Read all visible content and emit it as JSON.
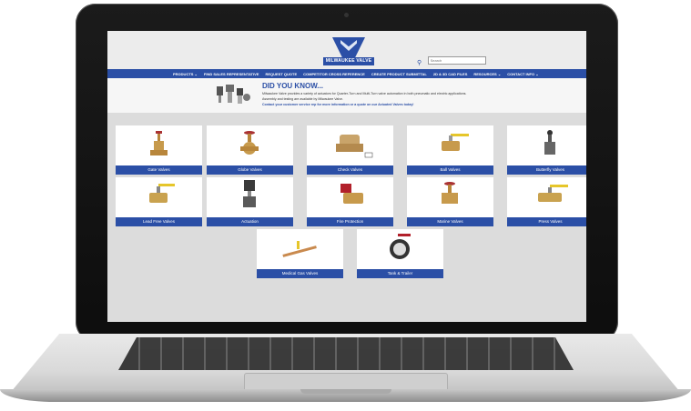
{
  "site": {
    "logo_text": "MILWAUKEE VALVE",
    "search_placeholder": "Search",
    "brand_color": "#2b4fa6"
  },
  "nav": [
    "PRODUCTS ⌄",
    "FIND SALES REPRESENTATIVE",
    "REQUEST QUOTE",
    "COMPETITOR CROSS REFERENCE",
    "CREATE PRODUCT SUBMITTAL",
    "2D & 3D CAD FILES",
    "RESOURCES ⌄",
    "CONTACT INFO ⌄"
  ],
  "did_you_know": {
    "title": "DID YOU KNOW...",
    "line1": "Milwaukee Valve provides a variety of actuators for Quarter-Turn and Multi-Turn valve automation in both pneumatic and electric applications.",
    "line2": "Assembly and testing are available by Milwaukee Valve.",
    "line3": "Contact your customer service rep for more information or a quote on our Actuated Valves today!"
  },
  "categories": [
    {
      "label": "Gate Valves",
      "icon": "gate-valve-icon"
    },
    {
      "label": "Globe Valves",
      "icon": "globe-valve-icon"
    },
    {
      "label": "Check Valves",
      "icon": "check-valve-icon"
    },
    {
      "label": "Ball Valves",
      "icon": "ball-valve-icon"
    },
    {
      "label": "Butterfly Valves",
      "icon": "butterfly-valve-icon"
    },
    {
      "label": "Lead Free Valves",
      "icon": "lead-free-valve-icon"
    },
    {
      "label": "Actuation",
      "icon": "actuator-icon"
    },
    {
      "label": "Fire Protection",
      "icon": "fire-protection-icon"
    },
    {
      "label": "Marine Valves",
      "icon": "marine-valve-icon"
    },
    {
      "label": "Press Valves",
      "icon": "press-valve-icon"
    },
    {
      "label": "Medical Gas Valves",
      "icon": "medical-gas-valve-icon"
    },
    {
      "label": "Tank & Trailer",
      "icon": "tank-trailer-valve-icon"
    }
  ]
}
